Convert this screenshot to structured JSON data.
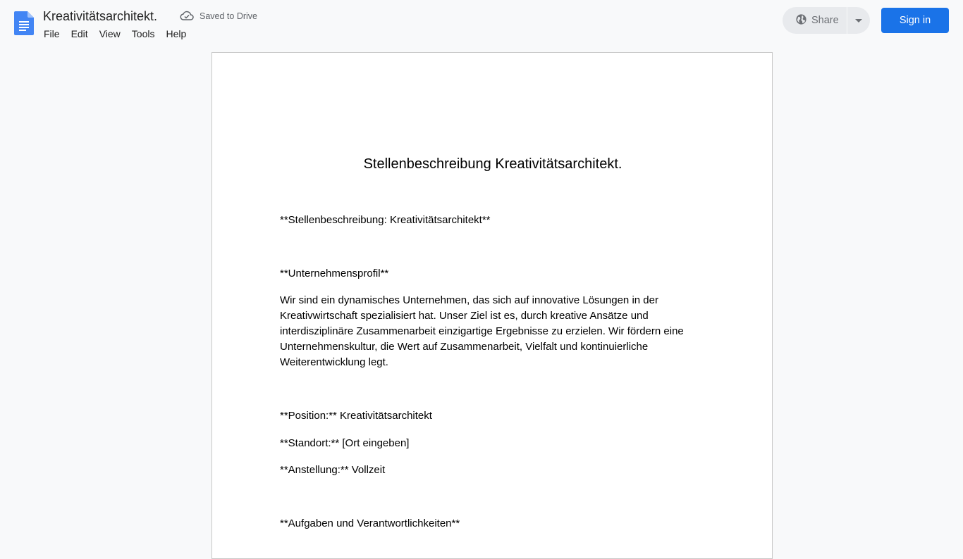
{
  "app": {
    "title": "Kreativitätsarchitekt.",
    "save_status": "Saved to Drive",
    "menu": [
      "File",
      "Edit",
      "View",
      "Tools",
      "Help"
    ],
    "share_label": "Share",
    "signin_label": "Sign in",
    "colors": {
      "accent": "#1a73e8",
      "docs_blue": "#4285f4",
      "background": "#f8f9fa"
    }
  },
  "document": {
    "heading": "Stellenbeschreibung Kreativitätsarchitekt.",
    "paragraphs": [
      "**Stellenbeschreibung: Kreativitätsarchitekt**",
      "**Unternehmensprofil**",
      "Wir sind ein dynamisches Unternehmen, das sich auf innovative Lösungen in der Kreativwirtschaft spezialisiert hat. Unser Ziel ist es, durch kreative Ansätze und interdisziplinäre Zusammenarbeit einzigartige Ergebnisse zu erzielen. Wir fördern eine Unternehmenskultur, die Wert auf Zusammenarbeit, Vielfalt und kontinuierliche Weiterentwicklung legt.",
      "**Position:** Kreativitätsarchitekt",
      "**Standort:** [Ort eingeben]",
      "**Anstellung:** Vollzeit",
      "**Aufgaben und Verantwortlichkeiten**"
    ]
  }
}
